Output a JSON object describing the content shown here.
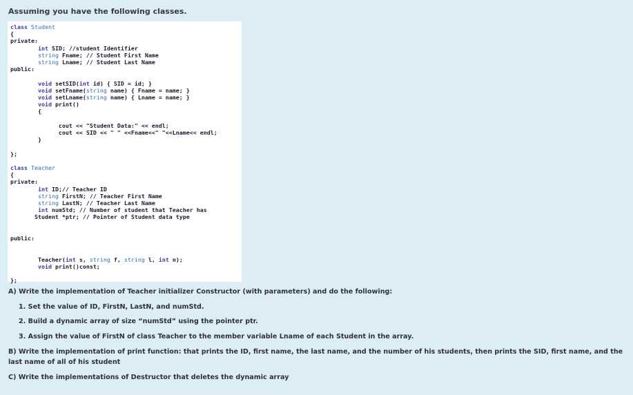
{
  "heading": "Assuming you have the following classes.",
  "code": [
    "class Student",
    "{",
    "private:",
    "        int SID; //student Identifier",
    "        string Fname; // Student First Name",
    "        string Lname; // Student Last Name",
    "public:",
    "",
    "        void setSID(int id) { SID = id; }",
    "        void setFname(string name) { Fname = name; }",
    "        void setLname(string name) { Lname = name; }",
    "        void print()",
    "        {",
    "",
    "              cout << \"Student Data:\" << endl;",
    "              cout << SID << \" \" <<Fname<<\" \"<<Lname<< endl;",
    "        }",
    "",
    "};",
    "",
    "class Teacher",
    "{",
    "private:",
    "        int ID;// Teacher ID",
    "        string FirstN; // Teacher First Name",
    "        string LastN; // Teacher Last Name",
    "        int numStd; // Number of student that Teacher has",
    "       Student *ptr; // Pointer of Student data type",
    "",
    "",
    "public:",
    "",
    "",
    "        Teacher(int s, string f, string l, int n);",
    "        void print()const;",
    "",
    "};"
  ],
  "questions": {
    "a": "A)   Write the implementation of Teacher initializer Constructor (with parameters) and do the following:",
    "a1": "1.  Set the value of ID, FirstN, LastN, and numStd.",
    "a2": "2.  Build a dynamic array of size “numStd” using the pointer ptr.",
    "a3": "3.  Assign the value of FirstN of class Teacher to the member variable Lname of each Student in the array.",
    "b": "B)   Write the implementation of print function: that prints the ID, first name, the last name, and the number of his students, then prints the SID, first name, and the last name of all of his student",
    "c": "C)   Write the implementations of Destructor that deletes the dynamic array"
  }
}
